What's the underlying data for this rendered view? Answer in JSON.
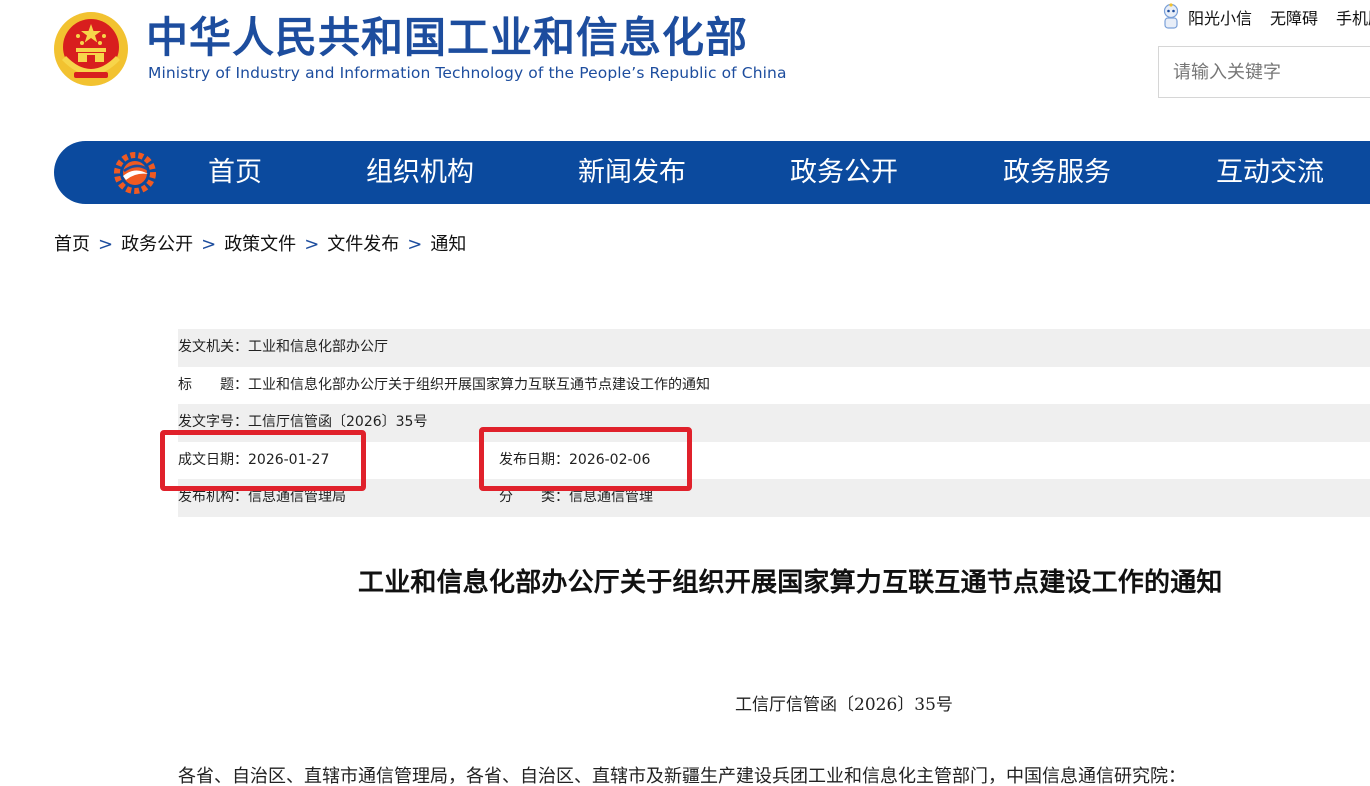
{
  "header": {
    "title_cn": "中华人民共和国工业和信息化部",
    "title_en": "Ministry of Industry and Information Technology of the People’s Republic of China",
    "top_links": [
      "阳光小信",
      "无障碍",
      "手机版"
    ],
    "search": {
      "placeholder": "请输入关键字"
    }
  },
  "nav": {
    "items": [
      "首页",
      "组织机构",
      "新闻发布",
      "政务公开",
      "政务服务",
      "互动交流"
    ]
  },
  "breadcrumb": [
    "首页",
    "政务公开",
    "政策文件",
    "文件发布",
    "通知"
  ],
  "meta": {
    "issuer_label": "发文机关：",
    "issuer": "工业和信息化部办公厅",
    "title_label": "标　　题：",
    "title": "工业和信息化部办公厅关于组织开展国家算力互联互通节点建设工作的通知",
    "docno_label": "发文字号：",
    "docno": "工信厅信管函〔2026〕35号",
    "written_label": "成文日期：",
    "written_date": "2026-01-27",
    "publish_label": "发布日期：",
    "publish_date": "2026-02-06",
    "org_label": "发布机构：",
    "org": "信息通信管理局",
    "category_label": "分　　类：",
    "category": "信息通信管理"
  },
  "article": {
    "title": "工业和信息化部办公厅关于组织开展国家算力互联互通节点建设工作的通知",
    "doc_no": "工信厅信管函〔2026〕35号",
    "salutation": "各省、自治区、直辖市通信管理局，各省、自治区、直辖市及新疆生产建设兵团工业和信息化主管部门，中国信息通信研究院："
  },
  "colors": {
    "brand_blue": "#1d4d9e",
    "nav_blue": "#0b4a9e",
    "highlight_red": "#e0212b",
    "row_shade": "#efefef"
  },
  "icons": [
    "national-emblem-icon",
    "sunshine-robot-icon",
    "miit-logo-icon"
  ]
}
